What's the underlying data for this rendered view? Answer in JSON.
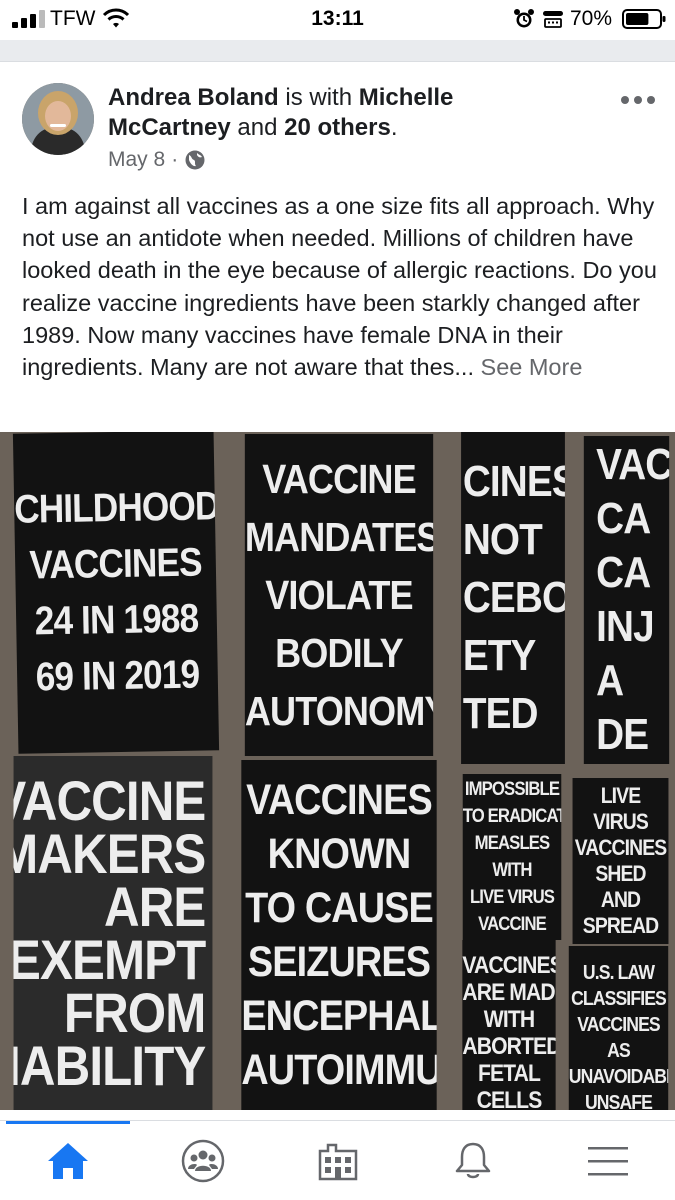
{
  "status_bar": {
    "carrier": "TFW",
    "time": "13:11",
    "battery_percent": "70%",
    "battery_level": 0.7,
    "icons": [
      "signal-icon",
      "wifi-icon",
      "alarm-icon",
      "tty-icon",
      "battery-icon"
    ]
  },
  "post": {
    "author": "Andrea Boland",
    "with_text": " is with ",
    "tagged_person": "Michelle McCartney",
    "and_text": " and ",
    "others": "20 others",
    "period": ".",
    "date": "May 8",
    "separator": "·",
    "audience_icon": "globe-icon",
    "body": "I am against all vaccines as a one size fits all approach. Why not use an antidote when needed. Millions of children have looked death in the eye because of allergic reactions. Do you realize vaccine ingredients have been starkly changed after 1989. Now many vaccines have female DNA in their ingredients. Many are not aware that thes...",
    "see_more": "See More",
    "more_icon": "more-options-icon"
  },
  "photos": {
    "sign1": [
      "CHILDHOOD",
      "VACCINES",
      "24 IN 1988",
      "69 IN 2019"
    ],
    "sign2": [
      "VACCINE",
      "MANDATES",
      "VIOLATE",
      "BODILY",
      "AUTONOMY"
    ],
    "sign3": [
      "CINES",
      "NOT",
      "CEBO",
      "ETY",
      "TED"
    ],
    "sign4": [
      "VACC",
      "CA",
      "CA",
      "INJ",
      "A",
      "DE"
    ],
    "sign5": [
      "VACCINE",
      "MAKERS",
      "ARE",
      "EXEMPT",
      "FROM",
      "LIABILITY"
    ],
    "sign6": [
      "VACCINES",
      "KNOWN",
      "TO CAUSE",
      "SEIZURES",
      "ENCEPHALITIS",
      "AUTOIMMUNITY"
    ],
    "sign7": [
      "IMPOSSIBLE",
      "TO ERADICATE",
      "MEASLES",
      "WITH",
      "LIVE VIRUS",
      "VACCINE"
    ],
    "sign8": [
      "LIVE",
      "VIRUS",
      "VACCINES",
      "SHED",
      "AND",
      "SPREAD"
    ],
    "sign9": [
      "VACCINES",
      "ARE MADE",
      "WITH",
      "ABORTED",
      "FETAL",
      "CELLS"
    ],
    "sign10": [
      "U.S. LAW",
      "CLASSIFIES",
      "VACCINES",
      "AS",
      "UNAVOIDABLY",
      "UNSAFE"
    ]
  },
  "tab_bar": {
    "tabs": [
      {
        "name": "home",
        "icon": "home-icon",
        "active": true
      },
      {
        "name": "groups",
        "icon": "groups-icon",
        "active": false
      },
      {
        "name": "marketplace",
        "icon": "marketplace-icon",
        "active": false
      },
      {
        "name": "notifications",
        "icon": "bell-icon",
        "active": false
      },
      {
        "name": "menu",
        "icon": "menu-icon",
        "active": false
      }
    ],
    "colors": {
      "active": "#1877f2",
      "inactive": "#65676b"
    }
  }
}
